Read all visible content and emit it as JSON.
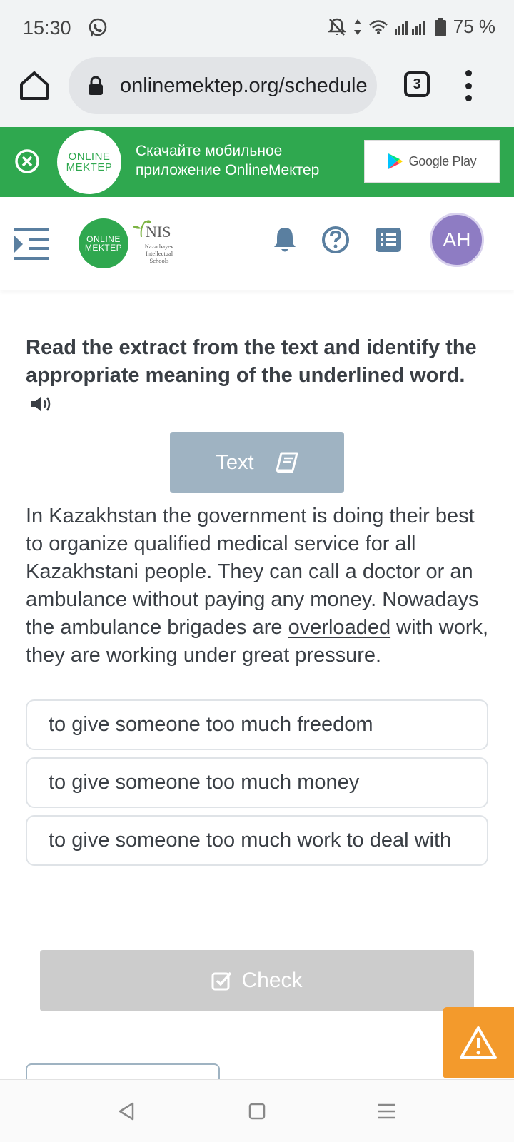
{
  "status_bar": {
    "time": "15:30",
    "battery": "75 %",
    "icons": [
      "whatsapp-icon",
      "bell-muted-icon",
      "data-arrows-icon",
      "wifi-icon",
      "signal-icon",
      "battery-icon"
    ]
  },
  "browser": {
    "url": "onlinemektep.org/schedule",
    "tab_count": "3"
  },
  "banner": {
    "logo_line1": "ONLINE",
    "logo_line2": "MEKTEP",
    "text_line1": "Скачайте мобильное",
    "text_line2": "приложение OnlineMeктер",
    "store_label": "Google Play",
    "color": "#2fa84f"
  },
  "header": {
    "logo_line1": "ONLINE",
    "logo_line2": "MEKTEP",
    "nis_title": "NIS",
    "nis_subtitle": "Nazarbayev Intellectual Schools",
    "avatar_initials": "AH",
    "avatar_color": "#8e7cc3"
  },
  "content": {
    "question": "Read the extract from the text and identify the appropriate meaning of the underlined word.",
    "text_button": "Text",
    "passage_before": "In Kazakhstan the government is doing their best to organize qualified medical service for all Kazakhstani people. They can call a doctor or an ambulance without paying any money. Nowadays the ambulance brigades are ",
    "passage_underlined": "overloaded",
    "passage_after": " with work, they are working under great pressure.",
    "options": [
      "to give someone too much freedom",
      "to give someone too much money",
      "to give someone too much work to deal with"
    ],
    "check_button": "Check"
  }
}
